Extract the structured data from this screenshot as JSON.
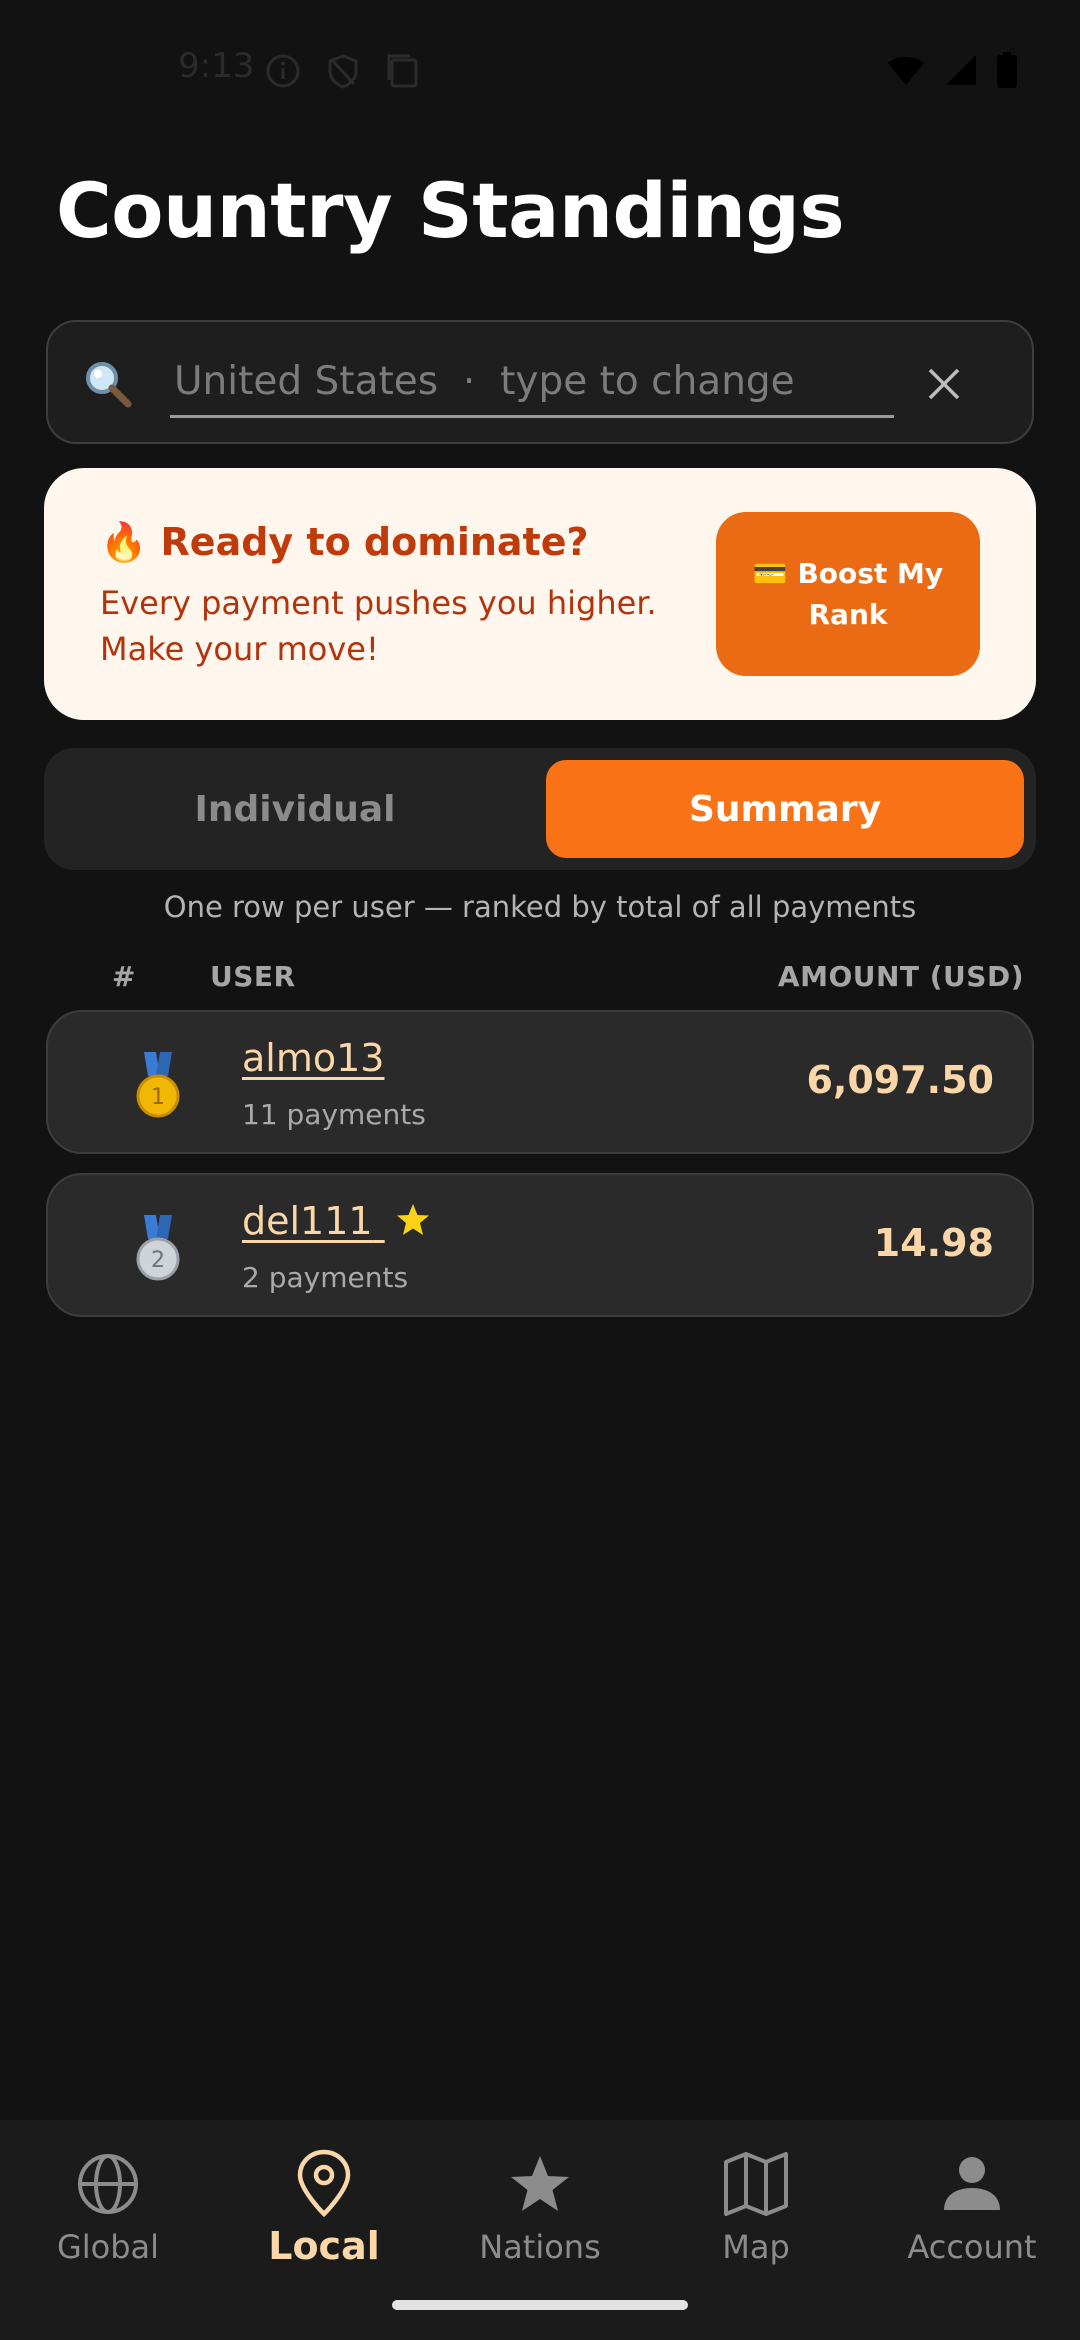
{
  "status_bar": {
    "time": "9:13"
  },
  "page": {
    "title": "Country Standings"
  },
  "search": {
    "value": "",
    "placeholder": "United States  ·  type to change"
  },
  "promo": {
    "title": "🔥 Ready to dominate?",
    "description": "Every payment pushes you higher. Make your move!",
    "button_label": "💳 Boost My Rank"
  },
  "view_toggle": {
    "tabs": [
      {
        "label": "Individual",
        "selected": false
      },
      {
        "label": "Summary",
        "selected": true
      }
    ]
  },
  "subtitle": "One row per user — ranked by total of all payments",
  "table": {
    "headers": {
      "rank": "#",
      "user": "USER",
      "amount": "AMOUNT (USD)"
    },
    "rows": [
      {
        "rank": 1,
        "medal_icon": "gold-medal-icon",
        "user": "almo13",
        "payments": "11 payments",
        "amount": "6,097.50",
        "starred": false
      },
      {
        "rank": 2,
        "medal_icon": "silver-medal-icon",
        "user": "del111",
        "payments": "2 payments",
        "amount": "14.98",
        "starred": true
      }
    ]
  },
  "bottom_nav": {
    "items": [
      {
        "label": "Global",
        "icon": "globe-icon",
        "active": false
      },
      {
        "label": "Local",
        "icon": "location-pin-icon",
        "active": true
      },
      {
        "label": "Nations",
        "icon": "star-icon",
        "active": false
      },
      {
        "label": "Map",
        "icon": "map-icon",
        "active": false
      },
      {
        "label": "Account",
        "icon": "person-icon",
        "active": false
      }
    ]
  },
  "colors": {
    "background": "#121212",
    "accent": "#f97316",
    "accent_text": "#fbd6a8",
    "promo_bg": "#fff6ee",
    "promo_text": "#bf3b0c"
  }
}
